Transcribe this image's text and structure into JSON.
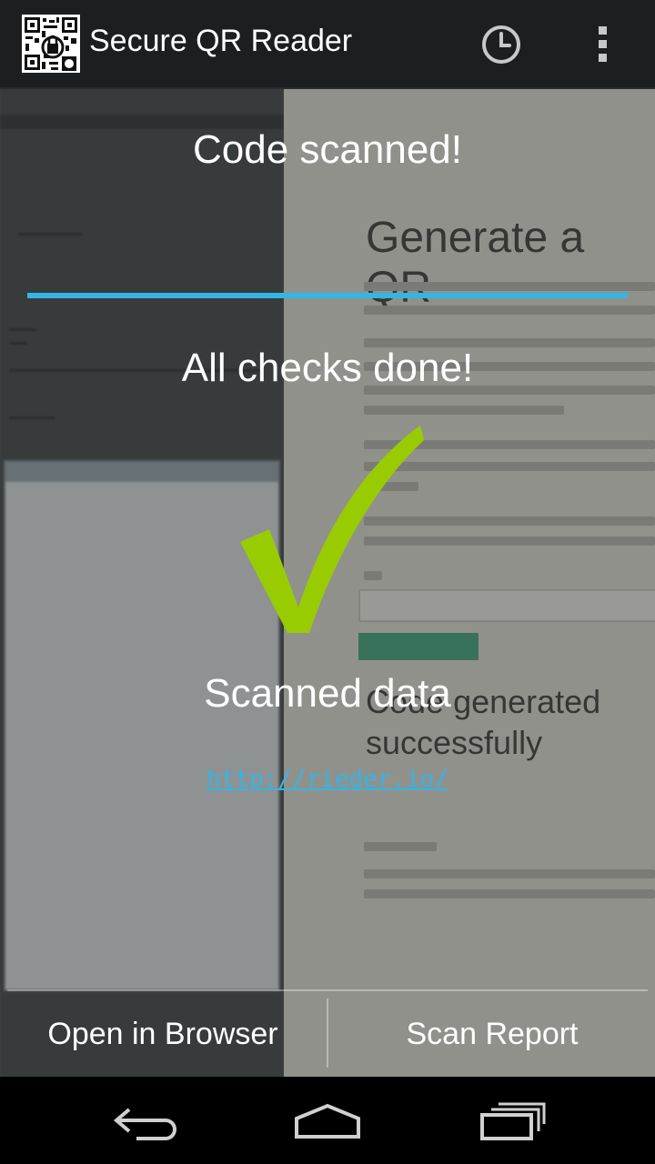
{
  "app": {
    "title": "Secure QR Reader",
    "icons": {
      "app": "qr-code-icon",
      "history": "clock-icon",
      "overflow": "more-vertical-icon"
    }
  },
  "scan": {
    "status_title": "Code scanned!",
    "checks_status": "All checks done!",
    "progress": 1.0,
    "result_icon": "checkmark-icon",
    "data_label": "Scanned data",
    "data_value": "http://rieder.io/"
  },
  "actions": {
    "open_browser": "Open in Browser",
    "scan_report": "Scan Report"
  },
  "navbar": {
    "icons": [
      "back-icon",
      "home-icon",
      "recents-icon"
    ]
  },
  "colors": {
    "accent": "#33b5e5",
    "check": "#99cc00",
    "actionbar": "#1d1e1f"
  }
}
